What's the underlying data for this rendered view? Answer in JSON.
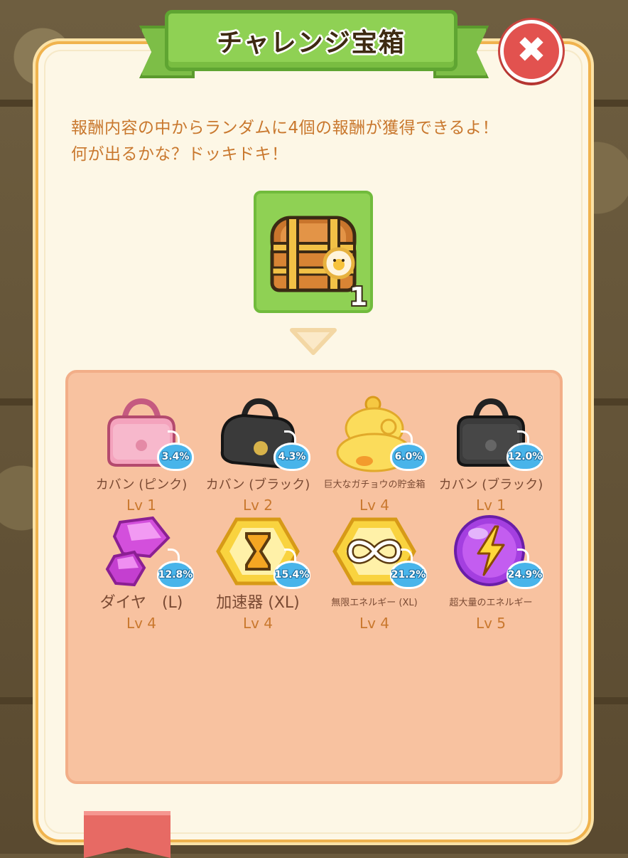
{
  "dialog": {
    "title": "チャレンジ宝箱",
    "close_label": "✖",
    "description_line1": "報酬内容の中からランダムに4個の報酬が獲得できるよ！",
    "description_line2": "何が出るかな？ドッキドキ！"
  },
  "chest": {
    "icon": "treasure-chest-icon",
    "count": "1",
    "tile_color": "#8fd154"
  },
  "rewards": [
    {
      "name": "カバン (ピンク)",
      "level": "Lv 1",
      "chance": "3.4%",
      "icon": "pink-bag-icon"
    },
    {
      "name": "カバン (ブラック)",
      "level": "Lv 2",
      "chance": "4.3%",
      "icon": "black-bag-icon"
    },
    {
      "name": "巨大なガチョウの貯金箱",
      "level": "Lv 4",
      "chance": "6.0%",
      "icon": "goose-piggy-bank-icon"
    },
    {
      "name": "カバン (ブラック)",
      "level": "Lv 1",
      "chance": "12.0%",
      "icon": "black-bag-icon"
    },
    {
      "name": "ダイヤ　(L)",
      "level": "Lv 4",
      "chance": "12.8%",
      "icon": "diamond-icon"
    },
    {
      "name": "加速器 (XL)",
      "level": "Lv 4",
      "chance": "15.4%",
      "icon": "hourglass-accelerator-icon"
    },
    {
      "name": "無限エネルギー (XL)",
      "level": "Lv 4",
      "chance": "21.2%",
      "icon": "infinity-energy-icon"
    },
    {
      "name": "超大量のエネルギー",
      "level": "Lv 5",
      "chance": "24.9%",
      "icon": "lightning-energy-icon"
    }
  ],
  "colors": {
    "panel_bg": "#fdf7e6",
    "banner_green": "#8fd154",
    "rewards_bg": "#f8c2a0",
    "badge_blue": "#48b4ea",
    "close_red": "#e2524f",
    "text_orange": "#c9782e"
  }
}
